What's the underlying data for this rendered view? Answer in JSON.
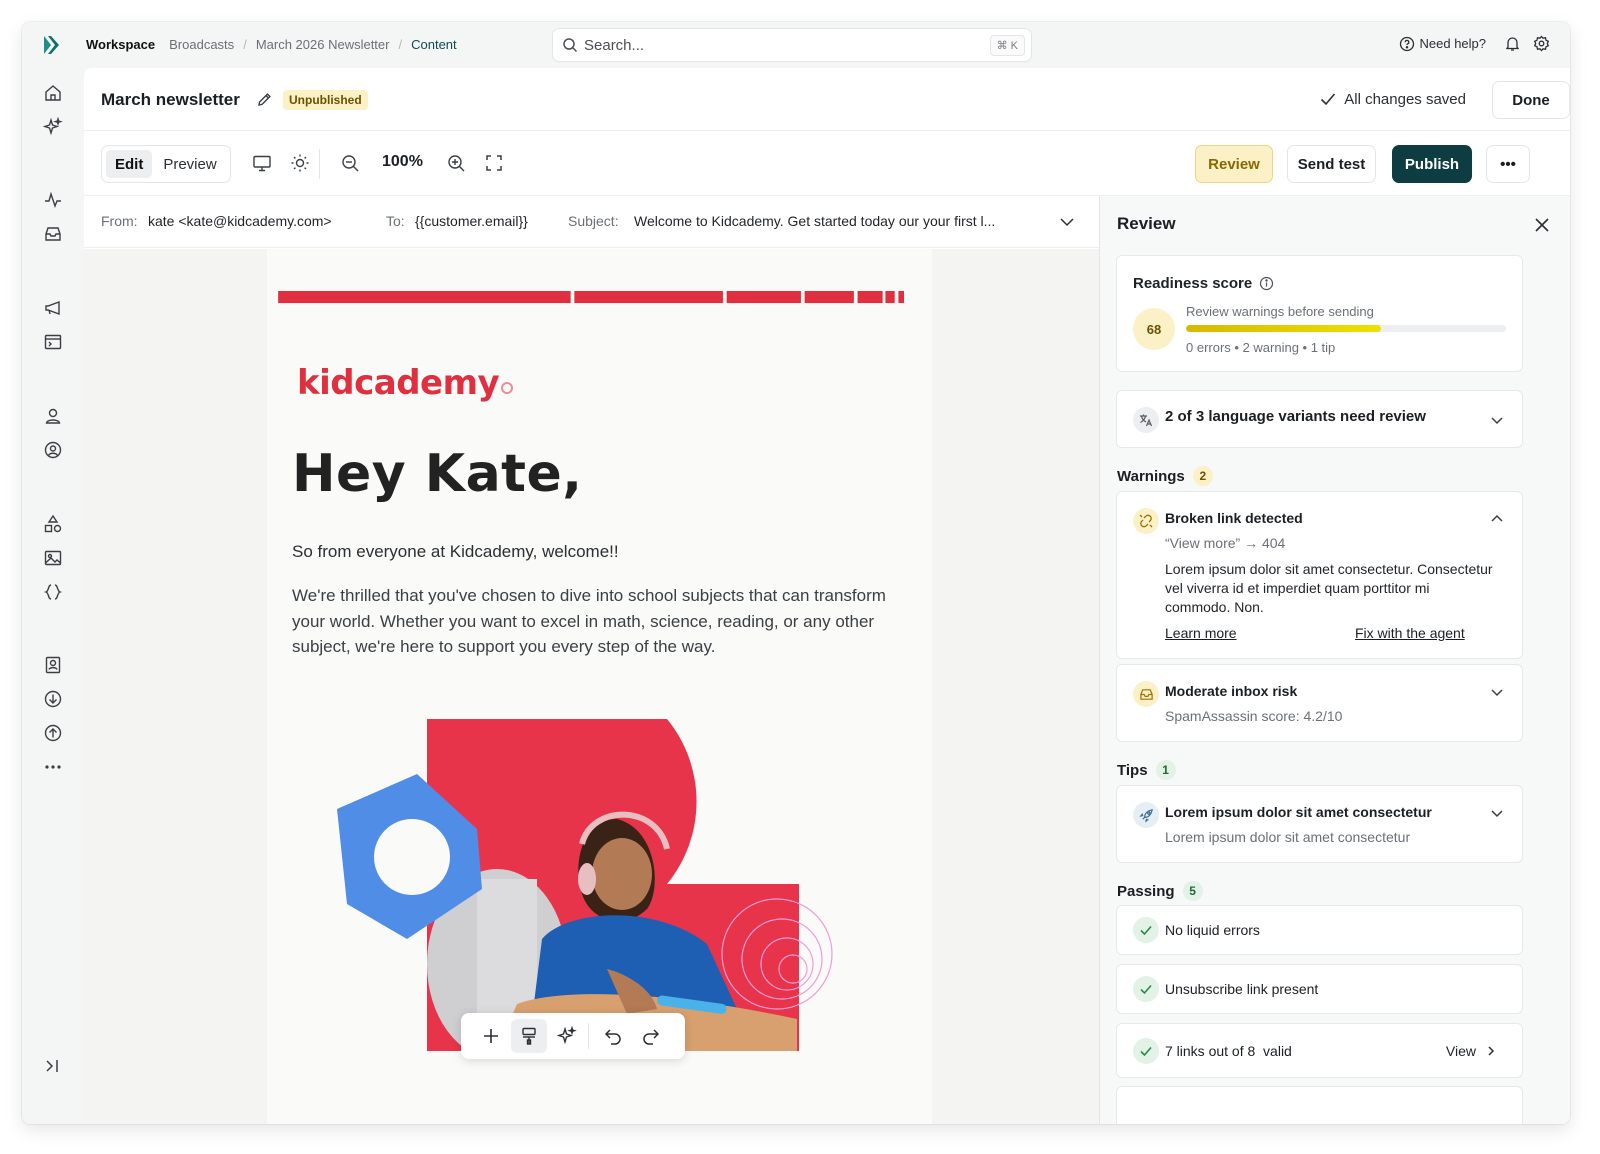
{
  "topbar": {
    "workspace": "Workspace",
    "breadcrumbs": [
      "Broadcasts",
      "March 2026 Newsletter",
      "Content"
    ],
    "search_placeholder": "Search...",
    "search_shortcut": "⌘ K",
    "help_label": "Need help?"
  },
  "header": {
    "title": "March newsletter",
    "status_badge": "Unpublished",
    "saved_status": "All changes saved",
    "done_label": "Done"
  },
  "toolbar": {
    "edit_label": "Edit",
    "preview_label": "Preview",
    "zoom_level": "100%",
    "review_label": "Review",
    "send_test_label": "Send test",
    "publish_label": "Publish",
    "more_label": "•••"
  },
  "meta": {
    "from_label": "From:",
    "from_value": "kate <kate@kidcademy.com>",
    "to_label": "To:",
    "to_value": "{{customer.email}}",
    "subject_label": "Subject:",
    "subject_value": "Welcome to Kidcademy. Get started today our your first l..."
  },
  "email": {
    "brand": "kidcademy",
    "greeting": "Hey Kate,",
    "intro": "So from everyone at Kidcademy, welcome!!",
    "body": "We're thrilled that you've chosen to dive into school subjects that can transform your world. Whether you want to excel in math, science, reading, or any other subject, we're here to support you every step of the way."
  },
  "review": {
    "title": "Review",
    "readiness": {
      "label": "Readiness score",
      "score": "68",
      "score_value": 61,
      "note": "Review warnings before sending",
      "summary": "0 errors • 2 warning • 1 tip"
    },
    "language_variants": "2 of 3 language variants need review",
    "warnings": {
      "label": "Warnings",
      "count": "2",
      "items": [
        {
          "title": "Broken link detected",
          "detail": "“View more” → 404",
          "description": "Lorem ipsum dolor sit amet consectetur. Consectetur vel viverra id et imperdiet quam porttitor mi commodo. Non.",
          "learn_more": "Learn more",
          "fix": "Fix with the agent"
        },
        {
          "title": "Moderate inbox risk",
          "detail": "SpamAssassin score: 4.2/10"
        }
      ]
    },
    "tips": {
      "label": "Tips",
      "count": "1",
      "items": [
        {
          "title": "Lorem ipsum dolor sit amet consectetur",
          "detail": "Lorem ipsum dolor sit amet consectetur"
        }
      ]
    },
    "passing": {
      "label": "Passing",
      "count": "5",
      "items": [
        {
          "title": "No liquid errors"
        },
        {
          "title": "Unsubscribe link present"
        },
        {
          "title": "7 links out of 8  valid",
          "action": "View"
        }
      ]
    }
  },
  "colors": {
    "brand_red": "#e0303f",
    "publish_bg": "#0d3d42",
    "warning_yellow": "#fbf0c6",
    "passing_green": "#2a8a45"
  }
}
